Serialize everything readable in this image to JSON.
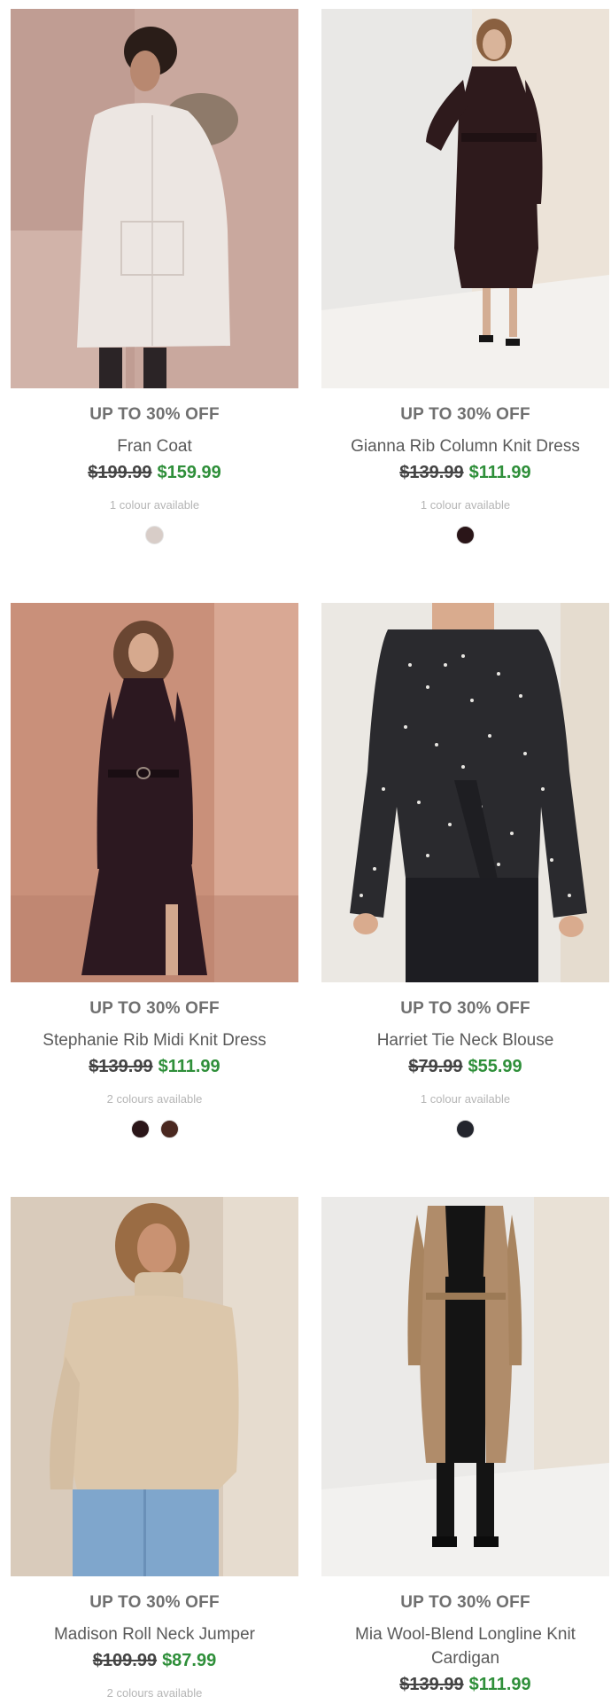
{
  "products": [
    {
      "promo": "UP TO 30% OFF",
      "name": "Fran Coat",
      "old_price": "$199.99",
      "new_price": "$159.99",
      "colours_text": "1 colour available",
      "swatches": [
        "#d8cdc8"
      ]
    },
    {
      "promo": "UP TO 30% OFF",
      "name": "Gianna Rib Column Knit Dress",
      "old_price": "$139.99",
      "new_price": "$111.99",
      "colours_text": "1 colour available",
      "swatches": [
        "#2a1518"
      ]
    },
    {
      "promo": "UP TO 30% OFF",
      "name": "Stephanie Rib Midi Knit Dress",
      "old_price": "$139.99",
      "new_price": "$111.99",
      "colours_text": "2 colours available",
      "swatches": [
        "#2a1518",
        "#4a2820"
      ]
    },
    {
      "promo": "UP TO 30% OFF",
      "name": "Harriet Tie Neck Blouse",
      "old_price": "$79.99",
      "new_price": "$55.99",
      "colours_text": "1 colour available",
      "swatches": [
        "#23252d"
      ]
    },
    {
      "promo": "UP TO 30% OFF",
      "name": "Madison Roll Neck Jumper",
      "old_price": "$109.99",
      "new_price": "$87.99",
      "colours_text": "2 colours available",
      "swatches": []
    },
    {
      "promo": "UP TO 30% OFF",
      "name": "Mia Wool-Blend Longline Knit Cardigan",
      "old_price": "$139.99",
      "new_price": "$111.99",
      "colours_text": "",
      "swatches": []
    }
  ],
  "colors": {
    "promo_text": "#707070",
    "sale_price": "#2f8f3a",
    "old_price": "#444444"
  }
}
